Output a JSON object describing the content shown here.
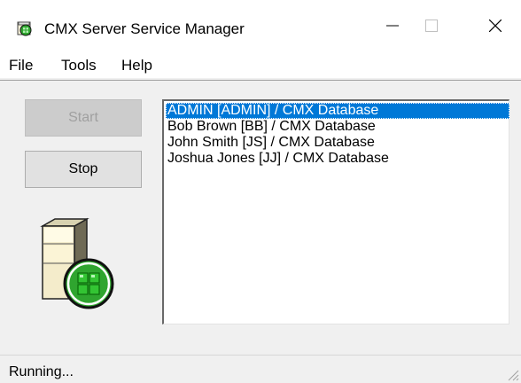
{
  "window": {
    "title": "CMX Server Service Manager",
    "icon": "cmx-app-icon"
  },
  "menu": {
    "items": [
      "File",
      "Tools",
      "Help"
    ]
  },
  "buttons": {
    "start": "Start",
    "stop": "Stop",
    "start_enabled": false
  },
  "users_list": {
    "items": [
      "ADMIN [ADMIN] / CMX Database",
      "Bob Brown [BB] / CMX Database",
      "John Smith [JS] / CMX Database",
      "Joshua Jones [JJ] / CMX Database"
    ],
    "selected_index": 0
  },
  "status": {
    "text": "Running..."
  },
  "colors": {
    "selection": "#0078d7",
    "accent_green": "#2fa52f"
  }
}
